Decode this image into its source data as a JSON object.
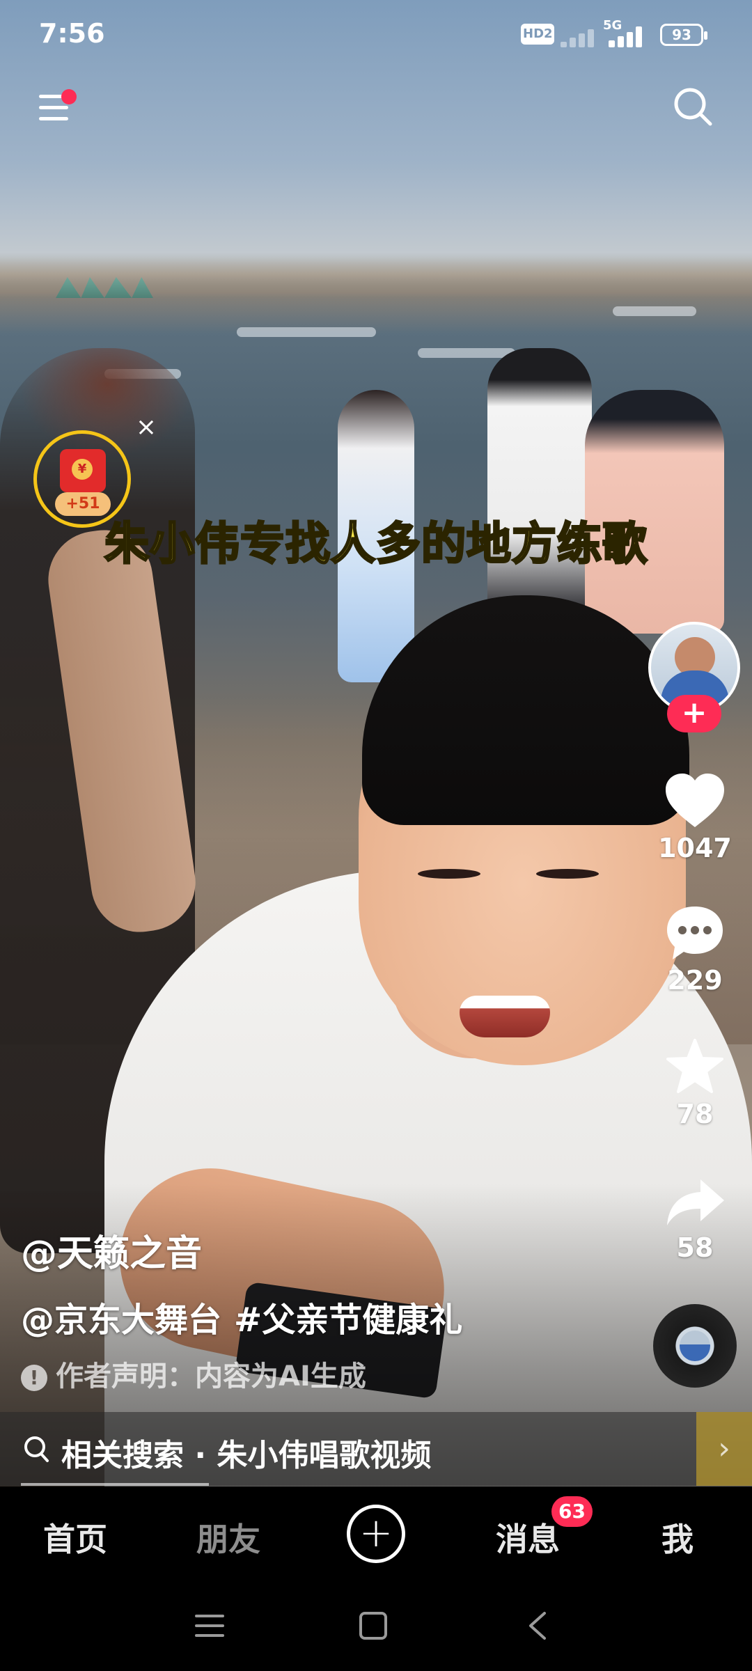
{
  "status_bar": {
    "time": "7:56",
    "hd_label": "HD2",
    "network_label": "5G",
    "battery": "93"
  },
  "top_bar": {
    "menu_icon": "menu-icon",
    "search_icon": "search-icon",
    "menu_notification_color": "#fe2c55"
  },
  "reward": {
    "points": "+51",
    "coin_glyph": "¥",
    "close_glyph": "×"
  },
  "video": {
    "subtitle": "朱小伟专找人多的地方练歌"
  },
  "rail": {
    "follow_glyph": "+",
    "likes": "1047",
    "comments": "229",
    "favorites": "78",
    "shares": "58"
  },
  "caption": {
    "author": "@天籁之音",
    "tags": [
      "@京东大舞台",
      "#父亲节健康礼"
    ],
    "ai_notice": "作者声明：内容为AI生成",
    "info_glyph": "!"
  },
  "related_search": {
    "text": "相关搜索 · 朱小伟唱歌视频",
    "arrow_glyph": "›"
  },
  "bottom_nav": {
    "home": "首页",
    "friends": "朋友",
    "create_glyph": "+",
    "messages": "消息",
    "messages_badge": "63",
    "me": "我"
  },
  "colors": {
    "accent": "#fe2c55",
    "subtitle": "#f7e64a",
    "reward_ring": "#f5c518"
  }
}
